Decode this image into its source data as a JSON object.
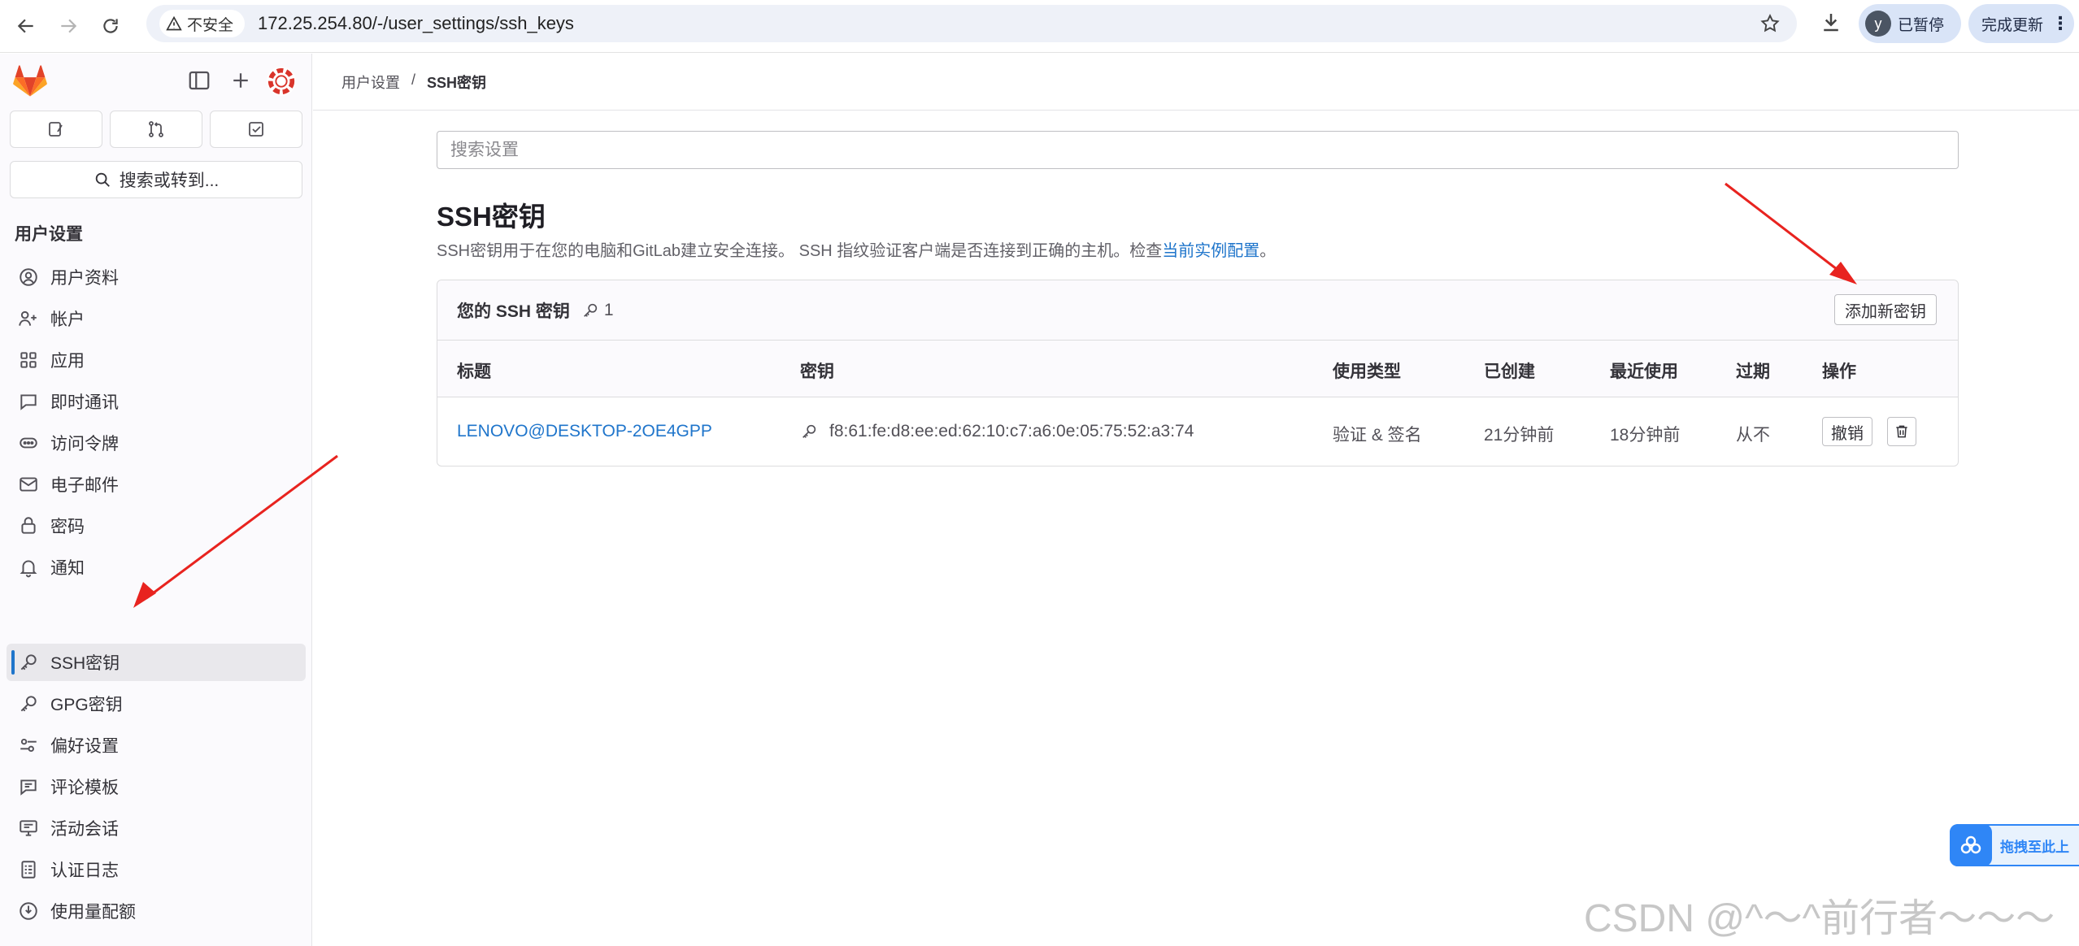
{
  "browser": {
    "security_label": "不安全",
    "url": "172.25.254.80/-/user_settings/ssh_keys",
    "profile_initial": "y",
    "profile_label": "已暂停",
    "update_label": "完成更新"
  },
  "sidebar": {
    "search_label": "搜索或转到...",
    "section_title": "用户设置",
    "items": [
      {
        "label": "用户资料",
        "icon": "profile-icon"
      },
      {
        "label": "帐户",
        "icon": "account-icon"
      },
      {
        "label": "应用",
        "icon": "applications-icon"
      },
      {
        "label": "即时通讯",
        "icon": "chat-icon"
      },
      {
        "label": "访问令牌",
        "icon": "token-icon"
      },
      {
        "label": "电子邮件",
        "icon": "mail-icon"
      },
      {
        "label": "密码",
        "icon": "lock-icon"
      },
      {
        "label": "通知",
        "icon": "bell-icon"
      },
      {
        "label": "SSH密钥",
        "icon": "key-icon",
        "active": true
      },
      {
        "label": "GPG密钥",
        "icon": "key-icon"
      },
      {
        "label": "偏好设置",
        "icon": "preferences-icon"
      },
      {
        "label": "评论模板",
        "icon": "comment-icon"
      },
      {
        "label": "活动会话",
        "icon": "monitor-icon"
      },
      {
        "label": "认证日志",
        "icon": "log-icon"
      },
      {
        "label": "使用量配额",
        "icon": "quota-icon"
      }
    ]
  },
  "breadcrumb": {
    "parent": "用户设置",
    "separator": "/",
    "current": "SSH密钥"
  },
  "main": {
    "search_placeholder": "搜索设置",
    "title": "SSH密钥",
    "description": "SSH密钥用于在您的电脑和GitLab建立安全连接。 SSH 指纹验证客户端是否连接到正确的主机。检查",
    "description_link": "当前实例配置",
    "description_end": "。"
  },
  "card": {
    "title": "您的 SSH 密钥",
    "count": "1",
    "add_button": "添加新密钥",
    "columns": {
      "title": "标题",
      "key": "密钥",
      "usage": "使用类型",
      "created": "已创建",
      "last_used": "最近使用",
      "expires": "过期",
      "actions": "操作"
    },
    "rows": [
      {
        "title": "LENOVO@DESKTOP-2OE4GPP",
        "fingerprint": "f8:61:fe:d8:ee:ed:62:10:c7:a6:0e:05:75:52:a3:74",
        "usage": "验证 & 签名",
        "created": "21分钟前",
        "last_used": "18分钟前",
        "expires": "从不",
        "revoke": "撤销"
      }
    ]
  },
  "overlay": {
    "widget_text": "拖拽至此上",
    "watermark": "CSDN @^～^前行者～～～",
    "arrow_color": "#e8231f"
  }
}
